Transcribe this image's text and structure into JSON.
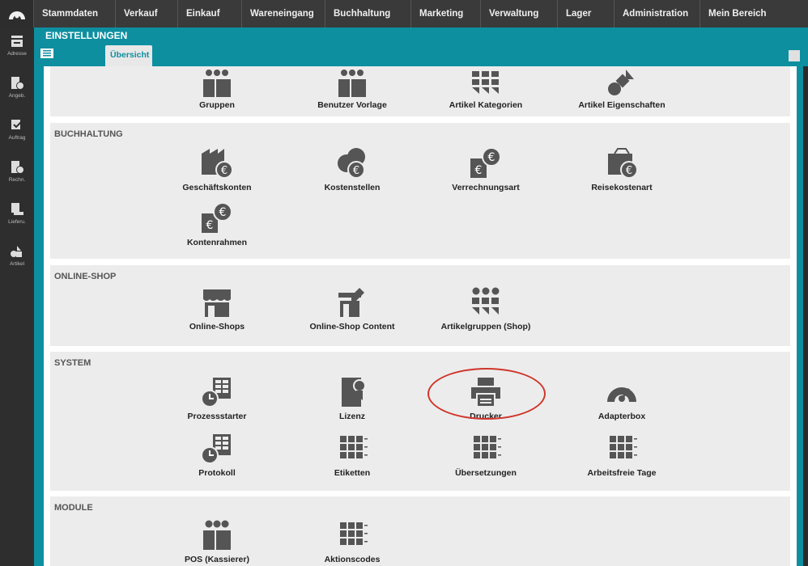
{
  "nav": [
    "Stammdaten",
    "Verkauf",
    "Einkauf",
    "Wareneingang",
    "Buchhaltung",
    "Marketing",
    "Verwaltung",
    "Lager",
    "Administration",
    "Mein Bereich"
  ],
  "sidebar": [
    {
      "label": "Adresse",
      "icon": "address-icon"
    },
    {
      "label": "Angeb.",
      "icon": "offer-icon"
    },
    {
      "label": "Auftrag",
      "icon": "order-icon"
    },
    {
      "label": "Rechn.",
      "icon": "invoice-icon"
    },
    {
      "label": "Lieferu.",
      "icon": "delivery-icon"
    },
    {
      "label": "Artikel",
      "icon": "article-icon"
    }
  ],
  "header": {
    "title": "EINSTELLUNGEN",
    "tab": "Übersicht"
  },
  "sections": {
    "top": {
      "items": [
        "Gruppen",
        "Benutzer Vorlage",
        "Artikel Kategorien",
        "Artikel Eigenschaften"
      ]
    },
    "buchhaltung": {
      "title": "BUCHHALTUNG",
      "items": [
        "Geschäftskonten",
        "Kostenstellen",
        "Verrechnungsart",
        "Reisekostenart",
        "Kontenrahmen"
      ]
    },
    "onlineshop": {
      "title": "ONLINE-SHOP",
      "items": [
        "Online-Shops",
        "Online-Shop Content",
        "Artikelgruppen (Shop)"
      ]
    },
    "system": {
      "title": "SYSTEM",
      "items": [
        "Prozessstarter",
        "Lizenz",
        "Drucker",
        "Adapterbox",
        "Protokoll",
        "Etiketten",
        "Übersetzungen",
        "Arbeitsfreie Tage"
      ]
    },
    "module": {
      "title": "MODULE",
      "items": [
        "POS (Kassierer)",
        "Aktionscodes"
      ]
    }
  },
  "colors": {
    "accent": "#0d8fa0",
    "icon": "#555555",
    "highlight": "#d0352a"
  }
}
